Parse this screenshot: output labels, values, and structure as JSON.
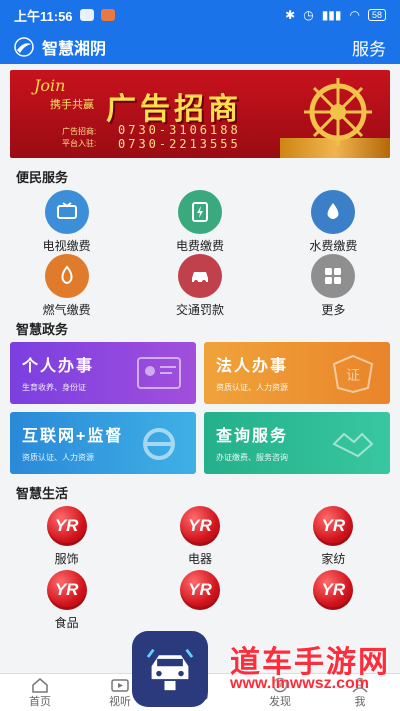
{
  "status_bar": {
    "time": "上午11:56",
    "battery": "58"
  },
  "app": {
    "title": "智慧湘阴",
    "service_label": "服务"
  },
  "banner": {
    "join": "Join",
    "join_sub": "携手共赢",
    "title": "广告招商",
    "contact_label_1": "广告招商:",
    "contact_label_2": "平台入驻:",
    "phone_1": "0730-3106188",
    "phone_2": "0730-2213555"
  },
  "sections": {
    "convenience": "便民服务",
    "government": "智慧政务",
    "life": "智慧生活"
  },
  "convenience_services": [
    {
      "label": "电视缴费",
      "icon": "tv-icon",
      "color": "#3d8ed8"
    },
    {
      "label": "电费缴费",
      "icon": "electricity-icon",
      "color": "#3aa97e"
    },
    {
      "label": "水费缴费",
      "icon": "water-drop-icon",
      "color": "#3a7fc7"
    },
    {
      "label": "燃气缴费",
      "icon": "gas-flame-icon",
      "color": "#e07b2c"
    },
    {
      "label": "交通罚款",
      "icon": "car-icon",
      "color": "#c0414c"
    },
    {
      "label": "更多",
      "icon": "more-grid-icon",
      "color": "#8f8f8f"
    }
  ],
  "government_cards": [
    {
      "title": "个人办事",
      "subtitle": "生育收养、身份证",
      "from": "#7b3fe0",
      "to": "#a14fdc",
      "icon": "id-card-icon"
    },
    {
      "title": "法人办事",
      "subtitle": "资质认证、人力资源",
      "from": "#f0a33a",
      "to": "#e9842a",
      "icon": "certificate-icon"
    },
    {
      "title": "互联网+监督",
      "subtitle": "资质认证、人力资源",
      "from": "#2a89d8",
      "to": "#3fb0e6",
      "icon": "ie-browser-icon"
    },
    {
      "title": "查询服务",
      "subtitle": "办证缴费、服务咨询",
      "from": "#23b08a",
      "to": "#38c7a0",
      "icon": "handshake-icon"
    }
  ],
  "life_items": [
    {
      "label": "服饰",
      "logo": "YR"
    },
    {
      "label": "电器",
      "logo": "YR"
    },
    {
      "label": "家纺",
      "logo": "YR"
    },
    {
      "label": "食品",
      "logo": "YR"
    },
    {
      "label": "",
      "logo": "YR"
    },
    {
      "label": "",
      "logo": "YR"
    }
  ],
  "bottom_nav": [
    {
      "label": "首页",
      "icon": "home-icon"
    },
    {
      "label": "视听",
      "icon": "video-icon"
    },
    {
      "label": "",
      "icon": "service-icon"
    },
    {
      "label": "发现",
      "icon": "discover-icon"
    },
    {
      "label": "我",
      "icon": "profile-icon"
    }
  ],
  "watermark": {
    "brand": "道车手游网",
    "url": "www.lmwwsz.com"
  }
}
